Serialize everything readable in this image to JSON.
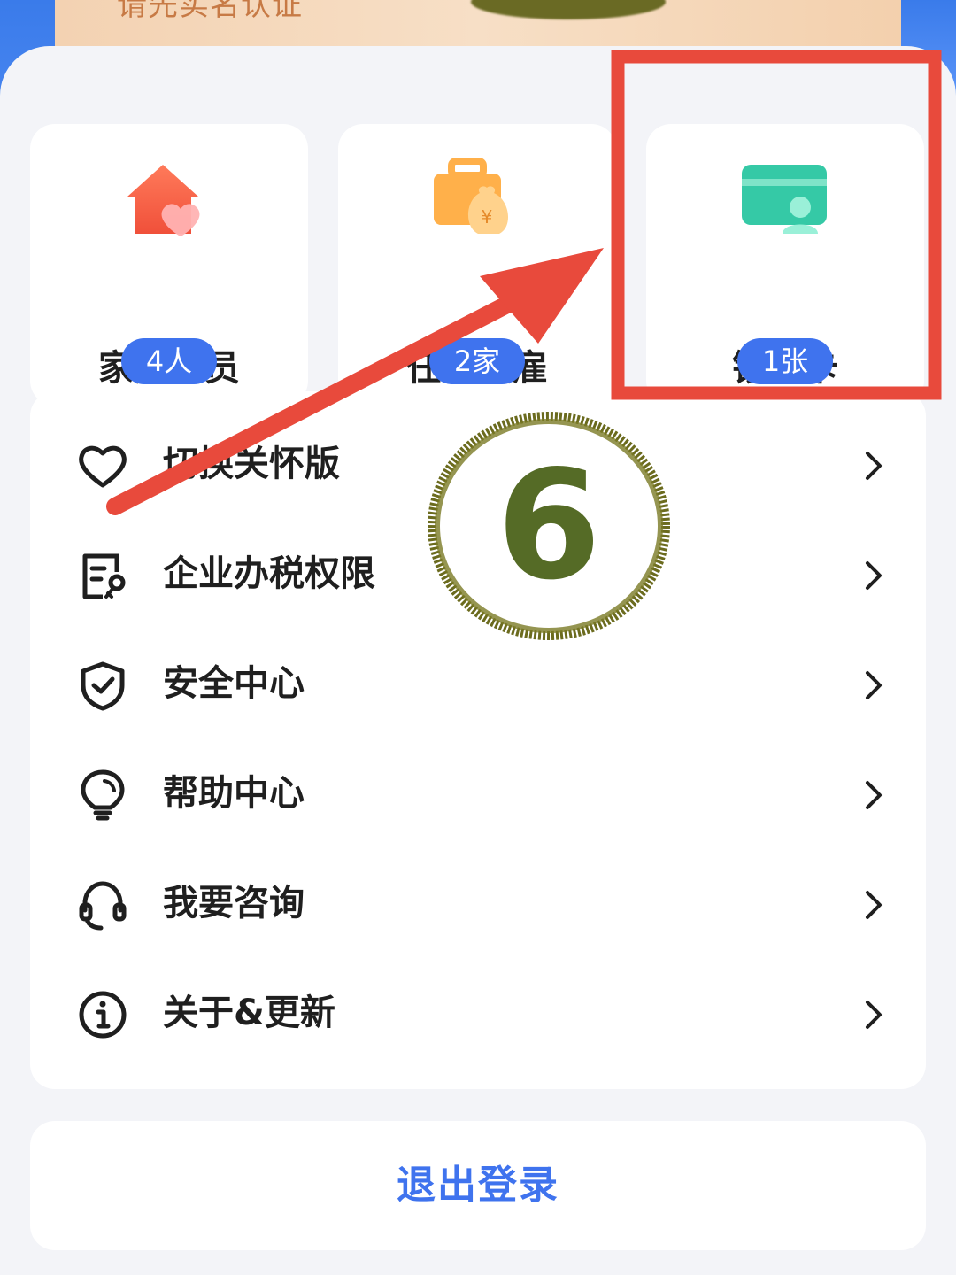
{
  "banner": {
    "text": "请先实名认证"
  },
  "cards": [
    {
      "label": "家庭成员",
      "badge": "4人",
      "icon": "family-house-heart-icon"
    },
    {
      "label": "任职受雇",
      "badge": "2家",
      "icon": "briefcase-money-bag-icon"
    },
    {
      "label": "银行卡",
      "badge": "1张",
      "icon": "bank-card-user-icon"
    }
  ],
  "menu": [
    {
      "label": "切换关怀版",
      "icon": "heart-outline-icon"
    },
    {
      "label": "企业办税权限",
      "icon": "document-key-icon"
    },
    {
      "label": "安全中心",
      "icon": "shield-check-icon"
    },
    {
      "label": "帮助中心",
      "icon": "lightbulb-icon"
    },
    {
      "label": "我要咨询",
      "icon": "headset-icon"
    },
    {
      "label": "关于&更新",
      "icon": "info-circle-icon"
    }
  ],
  "logout": {
    "label": "退出登录"
  },
  "annotation": {
    "step_number": "6"
  },
  "colors": {
    "accent_blue": "#3f73ee",
    "annotation_red": "#e84a3c",
    "annotation_olive": "#6b6b1e"
  }
}
